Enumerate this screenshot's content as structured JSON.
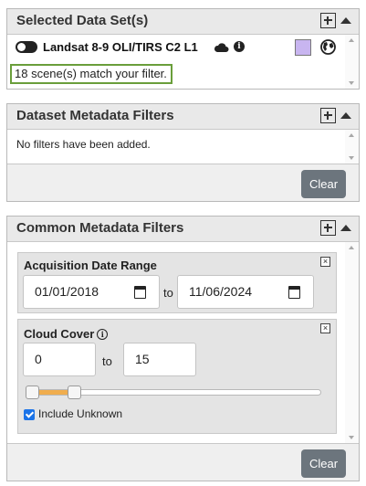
{
  "selected_panel": {
    "title": "Selected Data Set(s)",
    "dataset_name": "Landsat 8-9 OLI/TIRS C2 L1",
    "match_text": "18 scene(s) match your filter.",
    "swatch_color": "#c8b5f0",
    "icons": [
      "toggle-icon",
      "cloud-icon",
      "info-icon",
      "globe-icon"
    ]
  },
  "dataset_filters": {
    "title": "Dataset Metadata Filters",
    "empty_text": "No filters have been added.",
    "clear_label": "Clear"
  },
  "common_filters": {
    "title": "Common Metadata Filters",
    "acquisition": {
      "title": "Acquisition Date Range",
      "start": "01/01/2018",
      "to": "to",
      "end": "11/06/2024",
      "close": "×"
    },
    "cloud_cover": {
      "title": "Cloud Cover",
      "min": "0",
      "to": "to",
      "max": "15",
      "close": "×",
      "range_min": 0,
      "range_max": 100,
      "include_unknown_label": "Include Unknown",
      "include_unknown_checked": true
    },
    "clear_label": "Clear"
  },
  "colors": {
    "accent_green": "#6a9e3b",
    "clear_button": "#6c757d",
    "slider_fill": "#f0ad4e"
  }
}
